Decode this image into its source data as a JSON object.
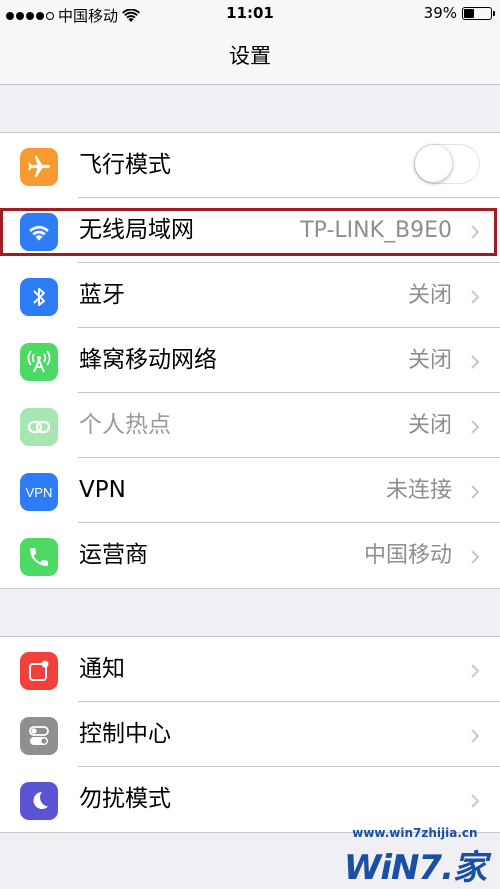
{
  "status_bar": {
    "carrier": "中国移动",
    "time": "11:01",
    "battery_text": "39%",
    "battery_level": 0.39
  },
  "nav": {
    "title": "设置"
  },
  "group1": [
    {
      "id": "airplane",
      "label": "飞行模式",
      "value": "",
      "control": "toggle",
      "toggle_on": false,
      "icon": "airplane-icon",
      "color": "#f79a32"
    },
    {
      "id": "wifi",
      "label": "无线局域网",
      "value": "TP-LINK_B9E0",
      "control": "chevron",
      "icon": "wifi-icon",
      "color": "#2e7cf6"
    },
    {
      "id": "bluetooth",
      "label": "蓝牙",
      "value": "关闭",
      "control": "chevron",
      "icon": "bluetooth-icon",
      "color": "#2e7cf6"
    },
    {
      "id": "cellular",
      "label": "蜂窝移动网络",
      "value": "关闭",
      "control": "chevron",
      "icon": "cellular-icon",
      "color": "#4cd964"
    },
    {
      "id": "hotspot",
      "label": "个人热点",
      "value": "关闭",
      "control": "chevron",
      "icon": "hotspot-icon",
      "color": "#a6e6b0",
      "dimmed": true
    },
    {
      "id": "vpn",
      "label": "VPN",
      "value": "未连接",
      "control": "chevron",
      "icon": "vpn-icon",
      "color": "#2e7cf6",
      "icon_text": "VPN"
    },
    {
      "id": "carrier",
      "label": "运营商",
      "value": "中国移动",
      "control": "chevron",
      "icon": "phone-icon",
      "color": "#4cd964"
    }
  ],
  "group2": [
    {
      "id": "notifications",
      "label": "通知",
      "value": "",
      "control": "chevron",
      "icon": "notifications-icon",
      "color": "#f2413b"
    },
    {
      "id": "control-center",
      "label": "控制中心",
      "value": "",
      "control": "chevron",
      "icon": "control-center-icon",
      "color": "#8e8e93"
    },
    {
      "id": "dnd",
      "label": "勿扰模式",
      "value": "",
      "control": "chevron",
      "icon": "moon-icon",
      "color": "#5a55d3"
    }
  ],
  "watermark": {
    "url": "www.win7zhijia.cn",
    "logo_text": "WiN7.家"
  }
}
